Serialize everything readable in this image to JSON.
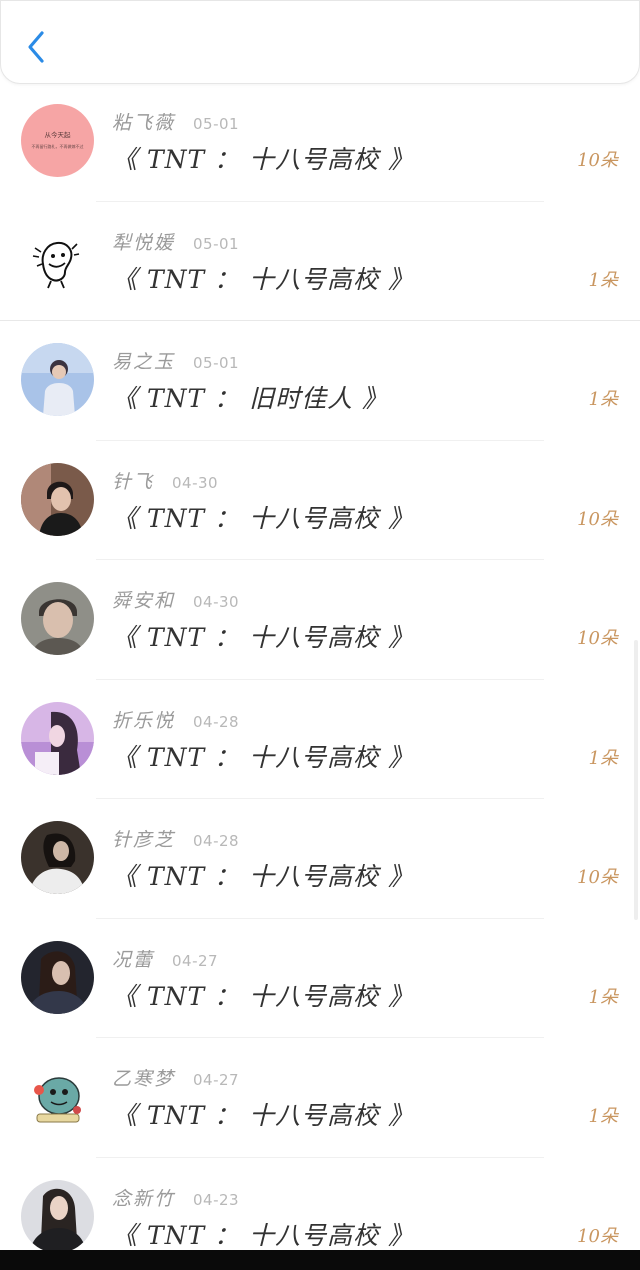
{
  "colors": {
    "back_icon": "#2b8be6",
    "name_text": "#9a9a9a",
    "date_text": "#b8b8b8",
    "title_text": "#333333",
    "amount_text": "#c99660",
    "bottom_bar": "#0a0a0a"
  },
  "header": {
    "back_icon": "chevron-left-icon"
  },
  "rows": [
    {
      "name": "粘飞薇",
      "date": "05-01",
      "title": "《 TNT ： 十八号高校 》",
      "amount": "10朵",
      "avatar": {
        "type": "pink-text",
        "line1": "从今天起",
        "line2": "不再留行路礼，不再做嫁不过"
      }
    },
    {
      "name": "犁悦媛",
      "date": "05-01",
      "title": "《 TNT ： 十八号高校 》",
      "amount": "1朵",
      "avatar": {
        "type": "doodle"
      }
    },
    {
      "name": "易之玉",
      "date": "05-01",
      "title": "《 TNT ： 旧时佳人 》",
      "amount": "1朵",
      "avatar": {
        "type": "photo-blue"
      }
    },
    {
      "name": "针飞",
      "date": "04-30",
      "title": "《 TNT ： 十八号高校 》",
      "amount": "10朵",
      "avatar": {
        "type": "photo-dark"
      }
    },
    {
      "name": "舜安和",
      "date": "04-30",
      "title": "《 TNT ： 十八号高校 》",
      "amount": "10朵",
      "avatar": {
        "type": "photo-grey"
      }
    },
    {
      "name": "折乐悦",
      "date": "04-28",
      "title": "《 TNT ： 十八号高校 》",
      "amount": "1朵",
      "avatar": {
        "type": "photo-purple"
      }
    },
    {
      "name": "针彦芝",
      "date": "04-28",
      "title": "《 TNT ： 十八号高校 》",
      "amount": "10朵",
      "avatar": {
        "type": "photo-mono"
      }
    },
    {
      "name": "况蕾",
      "date": "04-27",
      "title": "《 TNT ： 十八号高校 》",
      "amount": "1朵",
      "avatar": {
        "type": "photo-navy"
      }
    },
    {
      "name": "乙寒梦",
      "date": "04-27",
      "title": "《 TNT ： 十八号高校 》",
      "amount": "1朵",
      "avatar": {
        "type": "cartoon"
      }
    },
    {
      "name": "念新竹",
      "date": "04-23",
      "title": "《 TNT ： 十八号高校 》",
      "amount": "10朵",
      "avatar": {
        "type": "photo-light"
      }
    }
  ]
}
